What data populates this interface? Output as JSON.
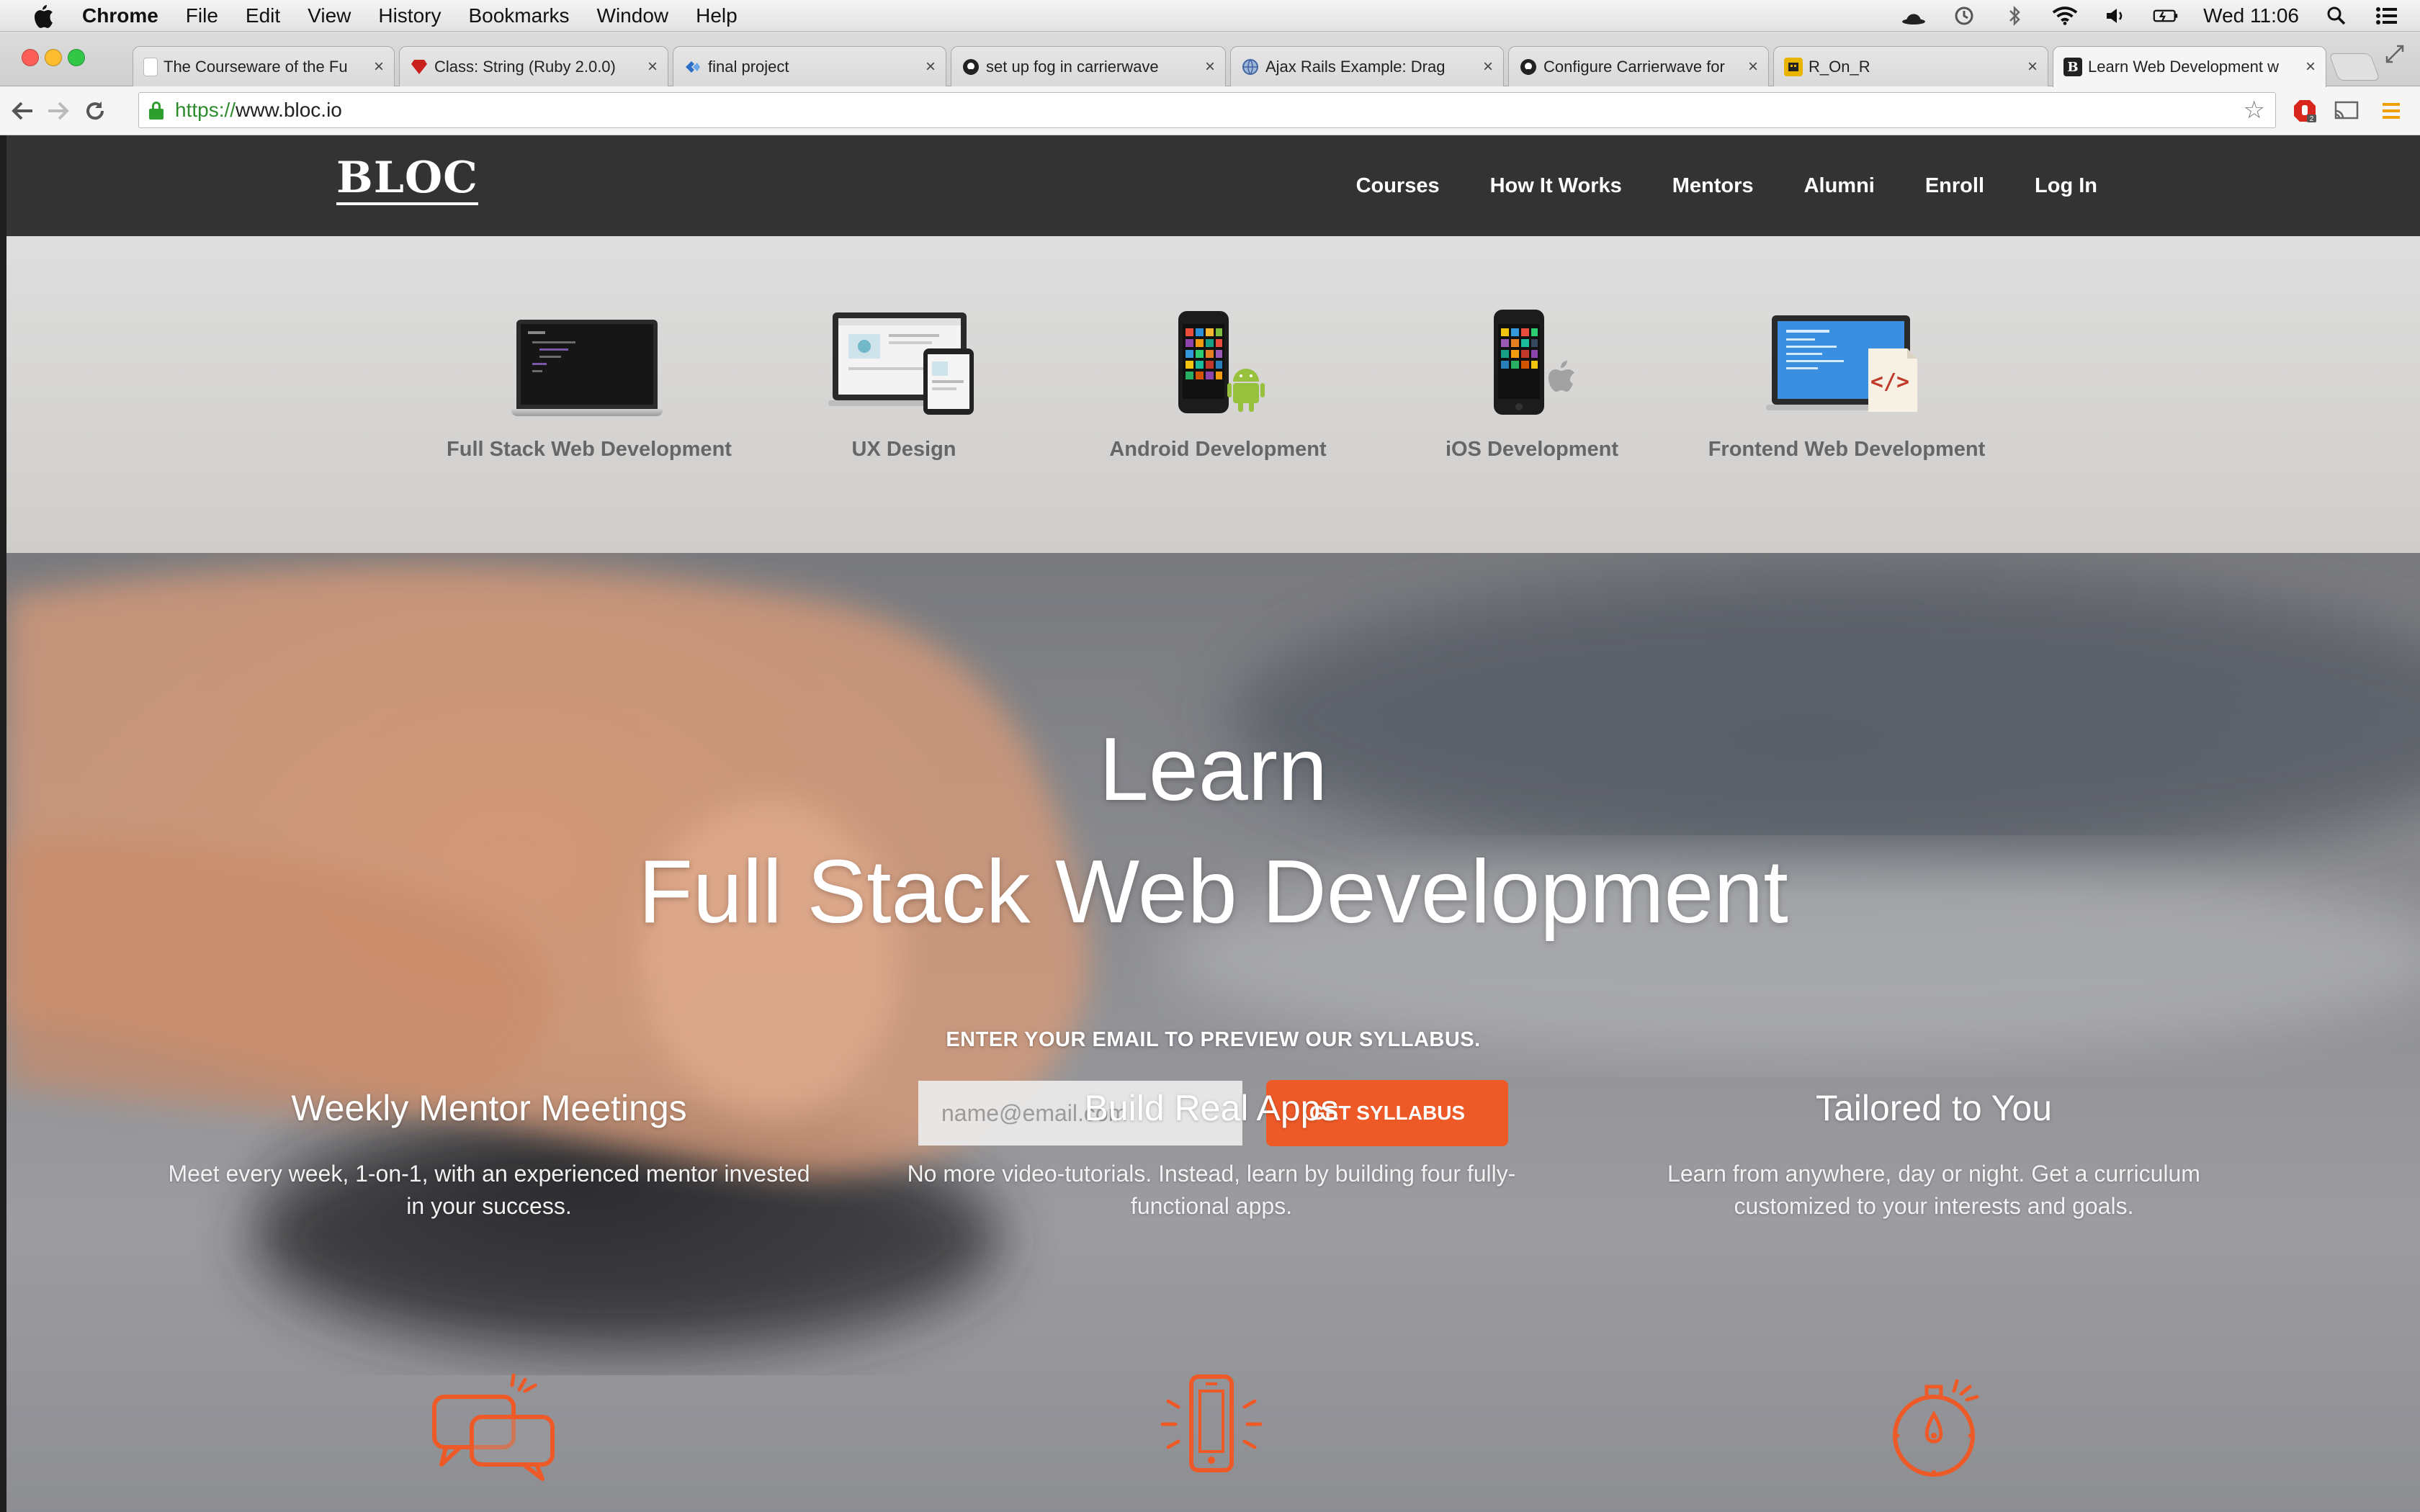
{
  "menubar": {
    "app": "Chrome",
    "items": [
      "File",
      "Edit",
      "View",
      "History",
      "Bookmarks",
      "Window",
      "Help"
    ],
    "clock": "Wed 11:06"
  },
  "tabs": [
    {
      "title": "The Courseware of the Fu",
      "favicon": "document-icon",
      "active": false
    },
    {
      "title": "Class: String (Ruby 2.0.0)",
      "favicon": "ruby-icon",
      "active": false
    },
    {
      "title": "final project",
      "favicon": "trello-icon",
      "active": false
    },
    {
      "title": "set up fog in carrierwave",
      "favicon": "github-icon",
      "active": false
    },
    {
      "title": "Ajax Rails Example: Drag",
      "favicon": "globe-icon",
      "active": false
    },
    {
      "title": "Configure Carrierwave for",
      "favicon": "github-icon",
      "active": false
    },
    {
      "title": "R_On_R",
      "favicon": "site-icon",
      "active": false
    },
    {
      "title": "Learn Web Development w",
      "favicon": "bloc-icon",
      "active": true
    }
  ],
  "omnibox": {
    "scheme": "https://",
    "host": "www.bloc.io"
  },
  "site": {
    "logo": "BLOC",
    "nav": [
      "Courses",
      "How It Works",
      "Mentors",
      "Alumni",
      "Enroll",
      "Log In"
    ]
  },
  "courses": [
    {
      "label": "Full Stack Web Development",
      "selected": true
    },
    {
      "label": "UX Design",
      "selected": false
    },
    {
      "label": "Android Development",
      "selected": false
    },
    {
      "label": "iOS Development",
      "selected": false
    },
    {
      "label": "Frontend Web Development",
      "selected": false
    }
  ],
  "hero": {
    "title_line1": "Learn",
    "title_line2": "Full Stack Web Development",
    "email_prompt": "ENTER YOUR EMAIL TO PREVIEW OUR SYLLABUS.",
    "email_placeholder": "name@email.com",
    "button_label": "GET SYLLABUS"
  },
  "features": [
    {
      "icon": "chat-bubbles-icon",
      "title": "Weekly Mentor Meetings",
      "desc": "Meet every week, 1-on-1, with an experienced mentor invested in your success."
    },
    {
      "icon": "smartphone-icon",
      "title": "Build Real Apps",
      "desc": "No more video-tutorials. Instead, learn by building four fully-functional apps."
    },
    {
      "icon": "stopwatch-icon",
      "title": "Tailored to You",
      "desc": "Learn from anywhere, day or night. Get a curriculum customized to your interests and goals."
    }
  ],
  "colors": {
    "accent": "#ee5a27",
    "nav_bg": "#333333",
    "course_bar_bg": "#d8d7d5"
  }
}
